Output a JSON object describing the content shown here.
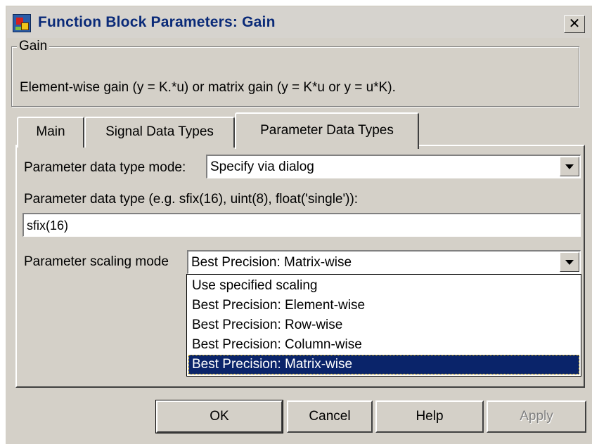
{
  "window": {
    "title": "Function Block Parameters: Gain",
    "close_label": "✕"
  },
  "group": {
    "title": "Gain",
    "description": "Element-wise gain (y = K.*u) or matrix gain (y = K*u or y = u*K)."
  },
  "tabs": [
    {
      "label": "Main",
      "selected": false
    },
    {
      "label": "Signal Data Types",
      "selected": false
    },
    {
      "label": "Parameter Data Types",
      "selected": true
    }
  ],
  "form": {
    "mode_label": "Parameter data type mode:",
    "mode_value": "Specify via dialog",
    "type_label": "Parameter data type (e.g. sfix(16), uint(8), float('single')):",
    "type_value": "sfix(16)",
    "scaling_label": "Parameter scaling mode",
    "scaling_value": "Best Precision: Matrix-wise",
    "scaling_options": [
      "Use specified scaling",
      "Best Precision: Element-wise",
      "Best Precision: Row-wise",
      "Best Precision: Column-wise",
      "Best Precision: Matrix-wise"
    ],
    "scaling_selected_index": 4
  },
  "buttons": {
    "ok": "OK",
    "cancel": "Cancel",
    "help": "Help",
    "apply": "Apply",
    "apply_enabled": false
  },
  "colors": {
    "dialog_bg": "#d4d0c8",
    "title_text": "#0a2a78",
    "selection_bg": "#0a246a"
  }
}
